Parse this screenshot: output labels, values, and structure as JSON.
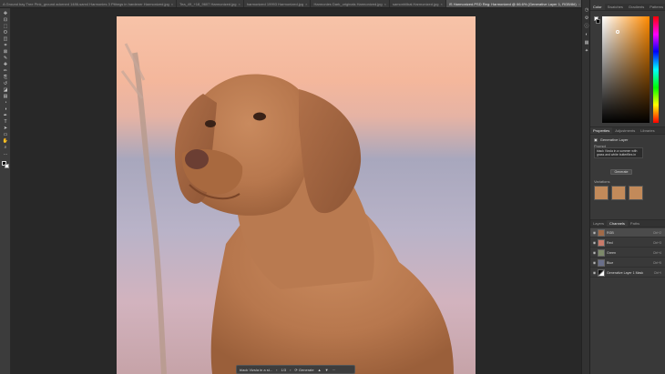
{
  "tabs": [
    {
      "label": "A Ground bay Tree Pink_ground adorned 1486-sam4 Harmonies 3 Pitbegs in hardener Harmonized.jpg",
      "active": false
    },
    {
      "label": "Tea_49_+18_9607 Harmonized.jpg",
      "active": false
    },
    {
      "label": "harmonized 19993 Harmonized.jpg",
      "active": false
    },
    {
      "label": "Harmonies Dark_originals Harmonized.jpg",
      "active": false
    },
    {
      "label": "samonhlibal.Harmonized.jpg",
      "active": false
    },
    {
      "label": "IS Harmonized.PSD Reg: Harmonized @ 66.6% (Generative Layer 1, RGB/8#)",
      "active": true
    }
  ],
  "toolbar": {
    "tools": [
      "move-tool-icon",
      "artboard-tool-icon",
      "marquee-tool-icon",
      "lasso-tool-icon",
      "object-select-tool-icon",
      "crop-tool-icon",
      "frame-tool-icon",
      "eyedropper-tool-icon",
      "healing-brush-icon",
      "brush-tool-icon",
      "clone-stamp-icon",
      "history-brush-icon",
      "eraser-tool-icon",
      "gradient-tool-icon",
      "blur-tool-icon",
      "dodge-tool-icon",
      "pen-tool-icon",
      "type-tool-icon",
      "path-select-icon",
      "rectangle-tool-icon",
      "hand-tool-icon",
      "zoom-tool-icon",
      "more-tools-icon"
    ],
    "glyphs": [
      "✥",
      "⊡",
      "⬚",
      "ʘ",
      "◫",
      "⌗",
      "⊠",
      "✎",
      "✚",
      "✏",
      "⎘",
      "↺",
      "◪",
      "▤",
      "◔",
      "◑",
      "✒",
      "T",
      "➤",
      "▭",
      "✋",
      "⌕",
      "…"
    ]
  },
  "canvas": {
    "image_label": "Dog portrait (Vizsla) photo",
    "background_colors": [
      "#f7c3a8",
      "#a8a7bd",
      "#c6a3a8"
    ]
  },
  "context_bar": {
    "prompt_value": "black Vizsla in a st...",
    "page": "1/3",
    "generate_label": "Generate",
    "icons": [
      "chevron-left-icon",
      "chevron-right-icon",
      "generate-icon",
      "thumb-up-icon",
      "thumb-down-icon",
      "more-icon"
    ]
  },
  "right_strip": {
    "icons": [
      "history-icon",
      "properties-icon",
      "info-icon",
      "adjustments-icon",
      "channels-icon",
      "paths-icon"
    ],
    "glyphs": [
      "◷",
      "⚙",
      "ⓘ",
      "◐",
      "▦",
      "✦"
    ]
  },
  "color_panel": {
    "tabs": [
      "Color",
      "Swatches",
      "Gradients",
      "Patterns"
    ],
    "active_tab": "Color",
    "selected_color": "#ff8a00"
  },
  "properties_panel": {
    "tabs": [
      "Properties",
      "Adjustments",
      "Libraries"
    ],
    "active_tab": "Properties",
    "header_label": "Generative Layer",
    "prompt_label": "Prompt",
    "prompt_text": "black Vizsla in a summer with grass and white butterflies in field",
    "generate_button": "Generate",
    "variations_label": "Variations",
    "thumbnails": 3
  },
  "layers_panel": {
    "tabs": [
      "Layers",
      "Channels",
      "Paths"
    ],
    "active_tab": "Channels",
    "rows": [
      {
        "name": "RGB",
        "shortcut": "Ctrl+2",
        "selected": true
      },
      {
        "name": "Red",
        "shortcut": "Ctrl+3",
        "selected": false
      },
      {
        "name": "Green",
        "shortcut": "Ctrl+4",
        "selected": false
      },
      {
        "name": "Blue",
        "shortcut": "Ctrl+5",
        "selected": false
      },
      {
        "name": "Generative Layer 1 Mask",
        "shortcut": "Ctrl+\\",
        "selected": false
      }
    ]
  }
}
